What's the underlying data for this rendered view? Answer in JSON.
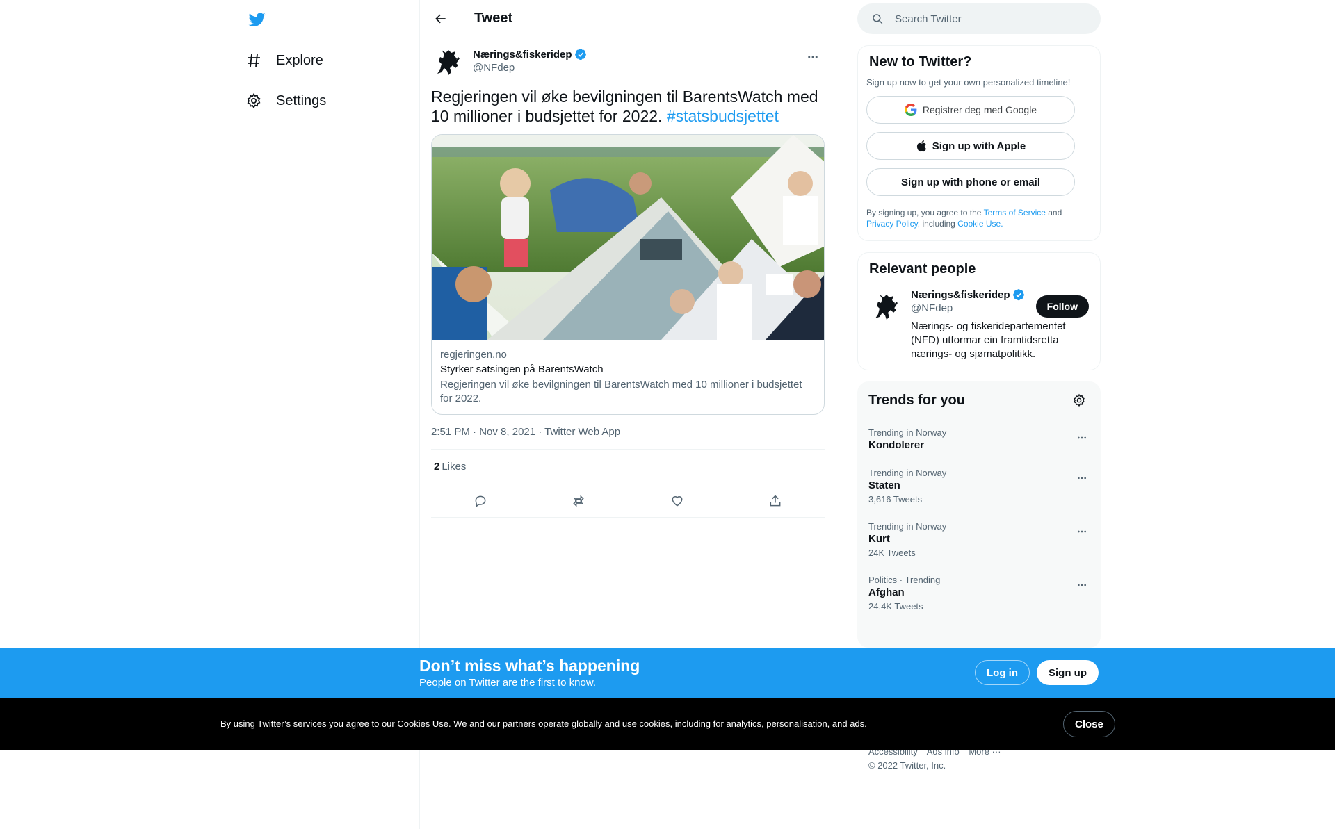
{
  "nav": {
    "items": [
      {
        "label": "Explore",
        "icon": "hashtag-icon"
      },
      {
        "label": "Settings",
        "icon": "gear-icon"
      }
    ]
  },
  "header": {
    "title": "Tweet"
  },
  "tweet": {
    "author_name": "Nærings&fiskeridep",
    "author_handle": "@NFdep",
    "text": "Regjeringen vil øke bevilgningen til BarentsWatch med 10 millioner i budsjettet for 2022. ",
    "hashtag": "#statsbudsjettet",
    "card": {
      "domain": "regjeringen.no",
      "title": "Styrker satsingen på BarentsWatch",
      "description": "Regjeringen vil øke bevilgningen til BarentsWatch med 10 millioner i budsjettet for 2022."
    },
    "time": "2:51 PM",
    "date": "Nov 8, 2021",
    "source": "Twitter Web App",
    "likes_count": "2",
    "likes_label": "Likes"
  },
  "search": {
    "placeholder": "Search Twitter"
  },
  "signup": {
    "title": "New to Twitter?",
    "subtitle": "Sign up now to get your own personalized timeline!",
    "google_label": "Registrer deg med Google",
    "apple_label": "Sign up with Apple",
    "phone_label": "Sign up with phone or email",
    "terms_prefix": "By signing up, you agree to the ",
    "terms_link": "Terms of Service",
    "terms_and": " and",
    "privacy_link": "Privacy Policy",
    "terms_including": ", including ",
    "cookie_link": "Cookie Use."
  },
  "people": {
    "title": "Relevant people",
    "name": "Nærings&fiskeridep",
    "handle": "@NFdep",
    "follow_label": "Follow",
    "bio": "Nærings- og fiskeridepartementet (NFD) utformar ein framtidsretta nærings- og sjømatpolitikk."
  },
  "trends": {
    "title": "Trends for you",
    "items": [
      {
        "context": "Trending in Norway",
        "name": "Kondolerer",
        "count": ""
      },
      {
        "context": "Trending in Norway",
        "name": "Staten",
        "count": "3,616 Tweets"
      },
      {
        "context": "Trending in Norway",
        "name": "Kurt",
        "count": "24K Tweets"
      },
      {
        "context": "Politics · Trending",
        "name": "Afghan",
        "count": "24.4K Tweets"
      }
    ]
  },
  "footer": {
    "links": [
      "Accessibility",
      "Ads info",
      "More ···"
    ],
    "copyright": "© 2022 Twitter, Inc."
  },
  "banner": {
    "title": "Don’t miss what’s happening",
    "subtitle": "People on Twitter are the first to know.",
    "login_label": "Log in",
    "signup_label": "Sign up"
  },
  "cookie_bar": {
    "text": "By using Twitter’s services you agree to our Cookies Use. We and our partners operate globally and use cookies, including for analytics, personalisation, and ads.",
    "close_label": "Close"
  },
  "colors": {
    "accent": "#1d9bf0",
    "text": "#0f1419",
    "secondary": "#536471",
    "cookie_bg": "#000000"
  }
}
